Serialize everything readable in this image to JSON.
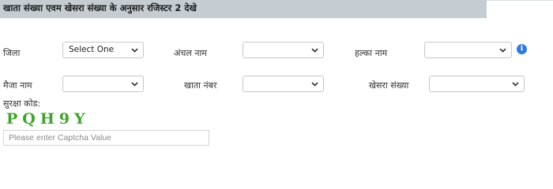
{
  "header": {
    "title": "खाता संख्या एवम खेसरा संख्या के अनुसार रजिस्टर 2 देखे"
  },
  "form": {
    "district": {
      "label": "जिला",
      "value": "Select One"
    },
    "circle": {
      "label": "अंचल नाम",
      "value": ""
    },
    "halka": {
      "label": "हल्का नाम",
      "value": ""
    },
    "mauza": {
      "label": "मैजा नाम",
      "value": ""
    },
    "khata": {
      "label": "खाता नंबर",
      "value": ""
    },
    "khesra": {
      "label": "खेसरा संख्या",
      "value": ""
    }
  },
  "captcha": {
    "label": "सुरक्षा कोड:",
    "code": "PQH9Y",
    "input_value": "",
    "placeholder": "Please enter Captcha Value"
  },
  "icons": {
    "info": "info-icon",
    "dropdown": "chevron-down-icon"
  },
  "colors": {
    "header_bg": "#c6cdd2",
    "captcha_text": "#3fa52a",
    "info_icon": "#2d7be0"
  }
}
